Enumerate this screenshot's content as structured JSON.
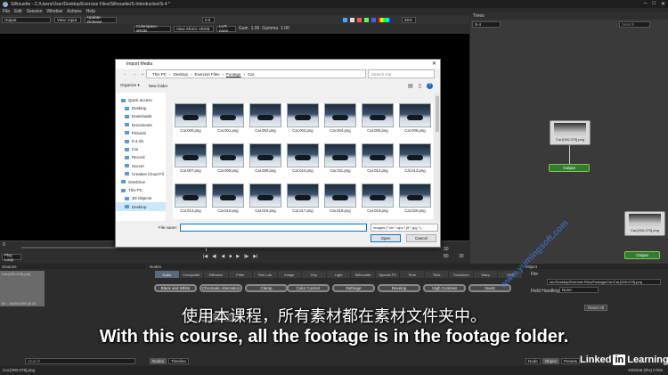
{
  "window": {
    "title": "Silhouette - C:/Users/User/Desktop/Exercise Files/Silhouette/S-Introduction/S-4 *"
  },
  "menu": [
    "File",
    "Edit",
    "Session",
    "Window",
    "Actions",
    "Help"
  ],
  "toolbar": {
    "output_mode": "Output",
    "view_input": "View: Input",
    "update": "Update: Release",
    "zoom": "0.0",
    "zoom_pct": "55%"
  },
  "toolbar2": {
    "colorspace_label": "Colorspace: sRGB",
    "view_xform": "View Xform: sRGB",
    "lut": "LUT: none",
    "gain_label": "Gain",
    "gain_value": "1.00",
    "gamma_label": "Gamma",
    "gamma_value": "1.00"
  },
  "trees": {
    "label": "Trees",
    "selected": "S-4",
    "search_placeholder": "Search"
  },
  "tree_nodes": {
    "source_label": "Car.[000-079].png",
    "output_label": "Output",
    "source_label2": "Car.[000-079].png",
    "output_label2": "Output"
  },
  "dialog": {
    "title": "Import Media",
    "breadcrumb": [
      "This PC",
      "Desktop",
      "Exercise Files",
      "Footage",
      "Car"
    ],
    "search_placeholder": "Search Car",
    "organize": "Organize ▾",
    "new_folder": "New folder",
    "nav": [
      "Quick access",
      "Desktop",
      "Downloads",
      "Documents",
      "Pictures",
      "0-4.sfx",
      "Car",
      "Record",
      "Soccer",
      "Creative Cloud Fil",
      "OneDrive",
      "This PC",
      "3D Objects",
      "Desktop"
    ],
    "files": [
      "Car.000.png",
      "Car.001.png",
      "Car.002.png",
      "Car.003.png",
      "Car.004.png",
      "Car.005.png",
      "Car.006.png",
      "Car.007.png",
      "Car.008.png",
      "Car.009.png",
      "Car.010.png",
      "Car.011.png",
      "Car.012.png",
      "Car.013.png",
      "Car.014.png",
      "Car.015.png",
      "Car.016.png",
      "Car.017.png",
      "Car.018.png",
      "Car.019.png",
      "Car.020.png"
    ],
    "file_name_label": "File name:",
    "file_type": "Images (*.cin *.dpx *.jff *.jpg *.j",
    "open": "Open",
    "cancel": "Cancel"
  },
  "timeline": {
    "start": "0",
    "end": "79",
    "current": "30",
    "end2": "80",
    "fps": "30",
    "loop": "Play Loop"
  },
  "sources": {
    "header": "Sources",
    "item": "Car.[000-079].png",
    "meta": "80 - 1920x1080 @ 30",
    "search_placeholder": "Search"
  },
  "nodes": {
    "header": "Nodes",
    "tabs": [
      "Color",
      "Composite",
      "Diffusion",
      "Filter",
      "Film Lab",
      "Image",
      "Key",
      "Light",
      "Silhouette",
      "Special FX",
      "Time",
      "Tints",
      "Transform",
      "Warp",
      "OFX"
    ],
    "buttons": [
      "Black and White",
      "Chromatic Aberration",
      "Clamp",
      "Color Correct",
      "Defringe",
      "Develop",
      "High Contrast",
      "Invert",
      "Quantize"
    ],
    "bottom_tabs": [
      "Nodes",
      "Timeline"
    ]
  },
  "object": {
    "header": "Object",
    "file_label": "File",
    "file_path": "ser/Desktop/Exercise Files/Footage/Car/Car.[000-079].png",
    "field_handling_label": "Field Handling",
    "field_handling_value": "None",
    "reset_all": "Reset All",
    "bottom_tabs": [
      "Node",
      "Object",
      "Presets"
    ]
  },
  "status": {
    "left": "Car.[000-079].png",
    "right": "10/2048 (0%) 8 bits"
  },
  "subtitles": {
    "cn": "使用本课程，所有素材都在素材文件夹中。",
    "en": "With this course, all the footage is in the footage folder."
  },
  "watermark": "www.yumingsoft.com",
  "brand": {
    "left": "Linked",
    "box": "in",
    "right": "Learning"
  }
}
